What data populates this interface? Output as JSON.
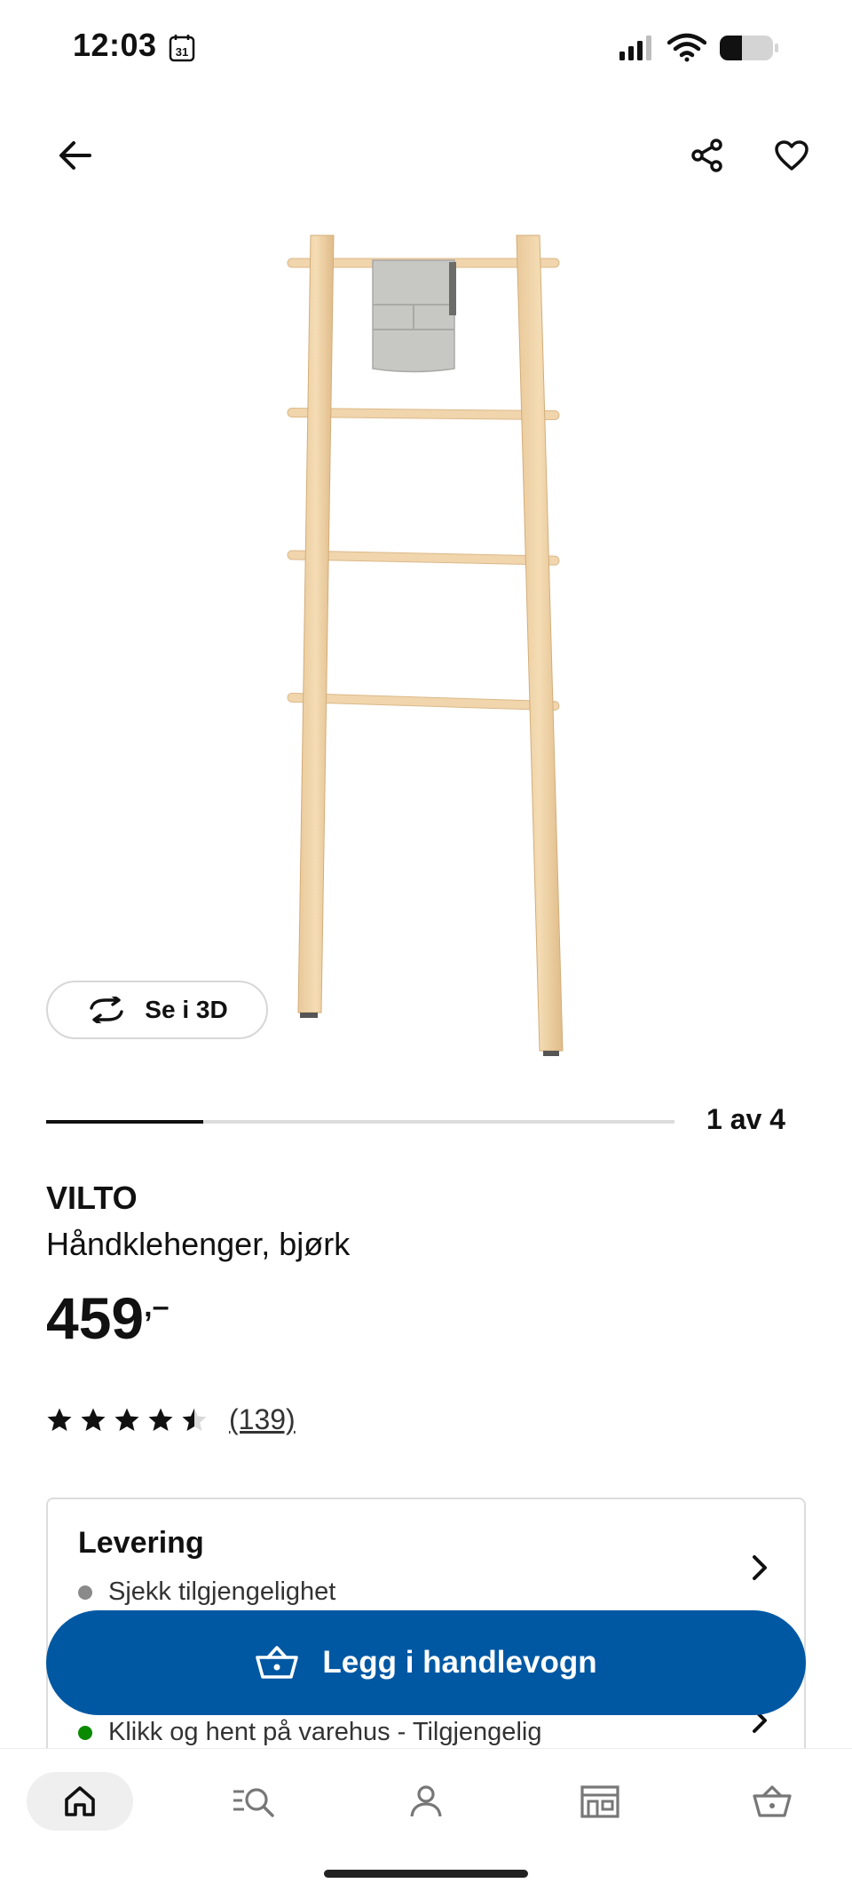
{
  "status_bar": {
    "time": "12:03",
    "calendar_day": "31"
  },
  "carousel": {
    "indicator_text": "1 av 4",
    "current": 1,
    "total": 4
  },
  "view_3d": {
    "label": "Se i 3D"
  },
  "product": {
    "brand": "VILTO",
    "description": "Håndklehenger, bjørk",
    "price": "459",
    "price_suffix": ",–",
    "rating_value": 4.5,
    "rating_max": 5,
    "review_count": "(139)"
  },
  "delivery": {
    "title": "Levering",
    "status": "Sjekk tilgjengelighet",
    "status_color": "#8a8a8a",
    "pickup_status": "Klikk og hent på varehus - Tilgjengelig",
    "pickup_color": "#0a8a00"
  },
  "add_to_cart": {
    "label": "Legg i handlevogn",
    "color": "#0058a3"
  },
  "bottom_nav": {
    "items": [
      {
        "icon": "home-icon",
        "active": true
      },
      {
        "icon": "search-list-icon",
        "active": false
      },
      {
        "icon": "profile-icon",
        "active": false
      },
      {
        "icon": "store-icon",
        "active": false
      },
      {
        "icon": "cart-icon",
        "active": false
      }
    ]
  }
}
